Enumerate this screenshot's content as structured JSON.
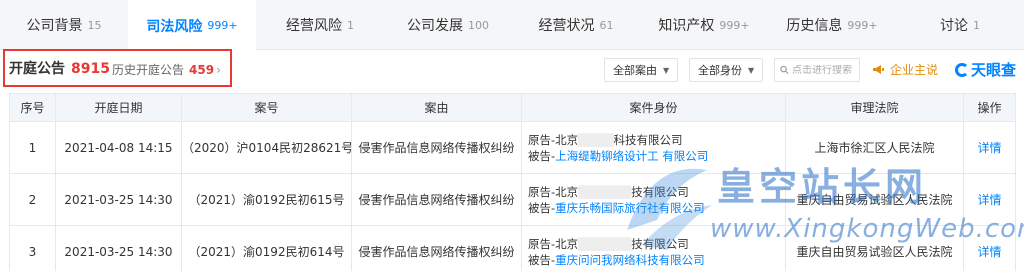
{
  "tabs": [
    {
      "label": "公司背景",
      "count": "15",
      "active": false
    },
    {
      "label": "司法风险",
      "count": "999+",
      "active": true
    },
    {
      "label": "经营风险",
      "count": "1",
      "active": false
    },
    {
      "label": "公司发展",
      "count": "100",
      "active": false
    },
    {
      "label": "经营状况",
      "count": "61",
      "active": false
    },
    {
      "label": "知识产权",
      "count": "999+",
      "active": false
    },
    {
      "label": "历史信息",
      "count": "999+",
      "active": false
    },
    {
      "label": "讨论",
      "count": "1",
      "active": false
    }
  ],
  "section": {
    "title": "开庭公告",
    "count": "8915",
    "history_label": "历史开庭公告",
    "history_count": "459",
    "history_arrow": "›"
  },
  "filters": {
    "case_reason": "全部案由",
    "identity": "全部身份",
    "search_placeholder": "点击进行搜索",
    "vip_label": "企业主说",
    "logo": "天眼查"
  },
  "table": {
    "headers": [
      "序号",
      "开庭日期",
      "案号",
      "案由",
      "案件身份",
      "审理法院",
      "操作"
    ],
    "rows": [
      {
        "index": "1",
        "date": "2021-04-08 14:15",
        "case_no": "（2020）沪0104民初28621号",
        "reason": "侵害作品信息网络传播权纠纷",
        "plaintiff": "原告-北京",
        "plaintiff_tail": "科技有限公司",
        "defendant_prefix": "被告-",
        "defendant": "上海缇勒铆络",
        "defendant_tail": "设计工 有限公司",
        "court": "上海市徐汇区人民法院",
        "action": "详情"
      },
      {
        "index": "2",
        "date": "2021-03-25 14:30",
        "case_no": "（2021）渝0192民初615号",
        "reason": "侵害作品信息网络传播权纠纷",
        "plaintiff": "原告-北京",
        "plaintiff_tail": "技有限公司",
        "defendant_prefix": "被告-",
        "defendant": "重庆乐畅国际旅行社有限公司",
        "defendant_tail": "",
        "court": "重庆自由贸易试验区人民法院",
        "action": "详情"
      },
      {
        "index": "3",
        "date": "2021-03-25 14:30",
        "case_no": "（2021）渝0192民初614号",
        "reason": "侵害作品信息网络传播权纠纷",
        "plaintiff": "原告-北京",
        "plaintiff_tail": "技有限公司",
        "defendant_prefix": "被告-",
        "defendant": "重庆问问我网络科技有限公司",
        "defendant_tail": "",
        "court": "重庆自由贸易试验区人民法院",
        "action": "详情"
      }
    ]
  },
  "watermark": {
    "cn": "皇空站长网",
    "en": "www.XingkongWeb.com"
  },
  "colors": {
    "accent": "#0084ff",
    "alert": "#e53935",
    "vip": "#e08e0b"
  }
}
